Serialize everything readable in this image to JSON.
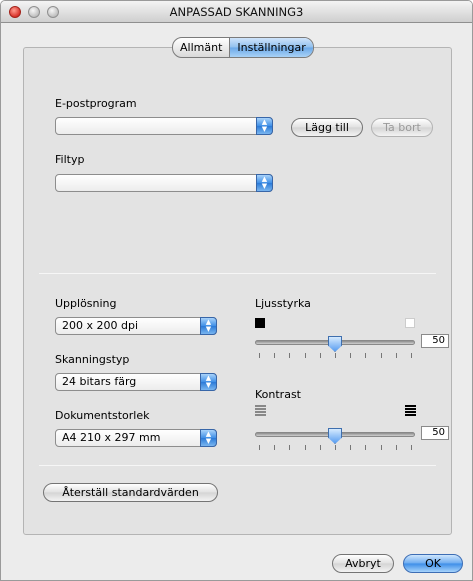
{
  "window": {
    "title": "ANPASSAD SKANNING3"
  },
  "tabs": [
    {
      "label": "Allmänt"
    },
    {
      "label": "Inställningar"
    }
  ],
  "email": {
    "label": "E-postprogram",
    "value": "",
    "add_label": "Lägg till",
    "remove_label": "Ta bort"
  },
  "filetype": {
    "label": "Filtyp",
    "value": ""
  },
  "resolution": {
    "label": "Upplösning",
    "value": "200 x 200 dpi"
  },
  "scantype": {
    "label": "Skanningstyp",
    "value": "24 bitars färg"
  },
  "docsize": {
    "label": "Dokumentstorlek",
    "value": "A4 210 x 297 mm"
  },
  "brightness": {
    "label": "Ljusstyrka",
    "value": "50",
    "level": 50
  },
  "contrast": {
    "label": "Kontrast",
    "value": "50",
    "level": 50
  },
  "reset": {
    "label": "Återställ standardvärden"
  },
  "footer": {
    "cancel_label": "Avbryt",
    "ok_label": "OK"
  },
  "colors": {
    "accent": "#3c8de8",
    "panel": "#e3e3e3",
    "window": "#ececec"
  },
  "icons": [
    "close-icon",
    "minimize-icon",
    "zoom-icon",
    "popup-arrows-icon",
    "dark-square-icon",
    "light-square-icon",
    "contrast-low-icon",
    "contrast-high-icon"
  ]
}
